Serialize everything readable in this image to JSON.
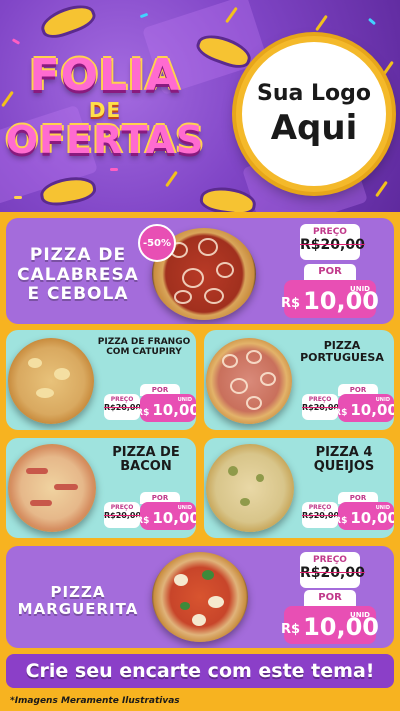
{
  "header": {
    "logo": {
      "line1": "FOLIA",
      "line2": "DE",
      "line3": "OFERTAS"
    },
    "brand": {
      "line1": "Sua Logo",
      "line2": "Aqui"
    }
  },
  "products": [
    {
      "title": "PIZZA DE CALABRESA E CEBOLA",
      "discount": "-50%",
      "old_label": "PREÇO",
      "old_price": "R$20,00",
      "por_label": "POR",
      "currency": "R$",
      "new_price": "10,00",
      "unit": "UNID"
    },
    {
      "title": "PIZZA DE FRANGO COM CATUPIRY",
      "old_label": "PREÇO",
      "old_price": "R$20,00",
      "por_label": "POR",
      "currency": "R$",
      "new_price": "10,00",
      "unit": "UNID"
    },
    {
      "title": "PIZZA PORTUGUESA",
      "old_label": "PREÇO",
      "old_price": "R$20,00",
      "por_label": "POR",
      "currency": "R$",
      "new_price": "10,00",
      "unit": "UNID"
    },
    {
      "title": "PIZZA DE BACON",
      "old_label": "PREÇO",
      "old_price": "R$20,00",
      "por_label": "POR",
      "currency": "R$",
      "new_price": "10,00",
      "unit": "UNID"
    },
    {
      "title": "PIZZA 4 QUEIJOS",
      "old_label": "PREÇO",
      "old_price": "R$20,00",
      "por_label": "POR",
      "currency": "R$",
      "new_price": "10,00",
      "unit": "UNID"
    },
    {
      "title": "PIZZA MARGUERITA",
      "old_label": "PREÇO",
      "old_price": "R$20,00",
      "por_label": "POR",
      "currency": "R$",
      "new_price": "10,00",
      "unit": "UNID"
    }
  ],
  "cta": "Crie seu encarte com este tema!",
  "disclaimer": "*Imagens Meramente Ilustrativas",
  "colors": {
    "purple_bg": "#8146c7",
    "panel_purple": "#a46cdb",
    "panel_mint": "#9fe3de",
    "accent_pink": "#e84fb4",
    "accent_yellow": "#f7b320"
  }
}
